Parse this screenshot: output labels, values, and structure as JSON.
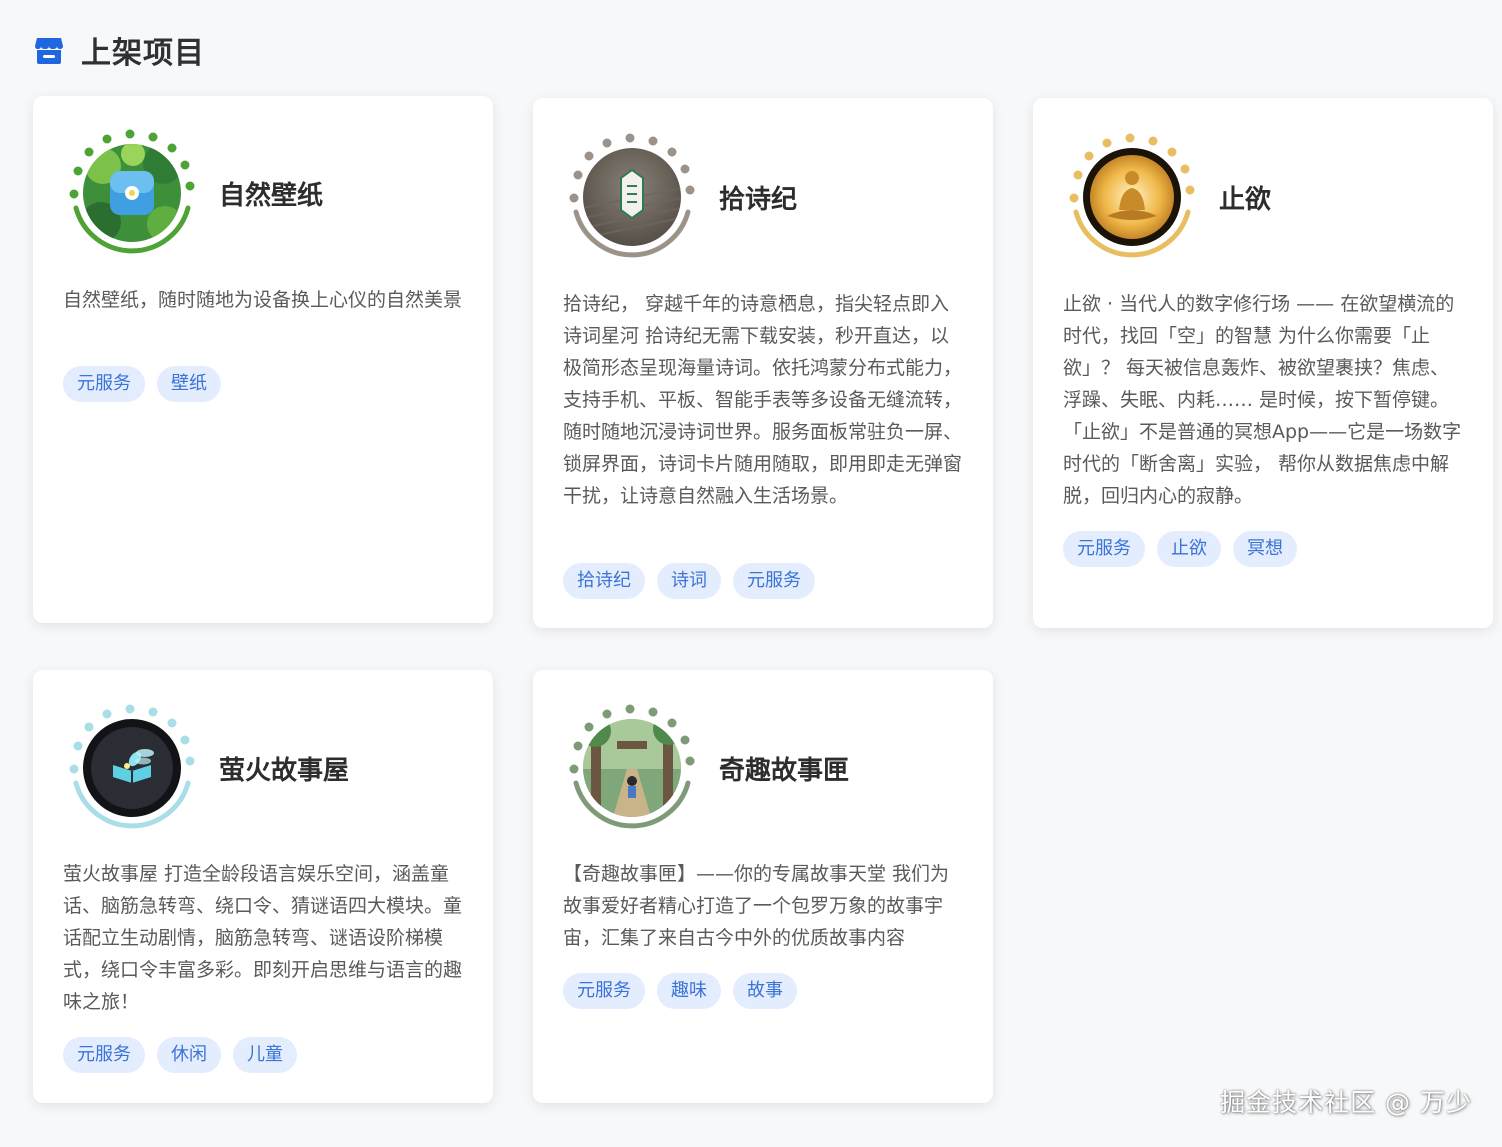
{
  "section": {
    "title": "上架项目",
    "icon": "store-icon"
  },
  "cards": [
    {
      "title": "自然壁纸",
      "avatar_icon": "nature-wallpaper-app-icon",
      "ring_color": "#4ea336",
      "description": "自然壁纸，随时随地为设备换上心仪的自然美景",
      "tags": [
        "元服务",
        "壁纸"
      ]
    },
    {
      "title": "拾诗纪",
      "avatar_icon": "poetry-seal-app-icon",
      "ring_color": "#9b9389",
      "description": "拾诗纪， 穿越千年的诗意栖息，指尖轻点即入诗词星河 拾诗纪无需下载安装，秒开直达，以极简形态呈现海量诗词。依托鸿蒙分布式能力，支持手机、平板、智能手表等多设备无缝流转，随时随地沉浸诗词世界。服务面板常驻负一屏、锁屏界面，诗词卡片随用随取，即用即走无弹窗干扰，让诗意自然融入生活场景。",
      "tags": [
        "拾诗纪",
        "诗词",
        "元服务"
      ]
    },
    {
      "title": "止欲",
      "avatar_icon": "meditation-app-icon",
      "ring_color": "#e9bd62",
      "description": "止欲 · 当代人的数字修行场 —— 在欲望横流的时代，找回「空」的智慧 为什么你需要「止欲」？ 每天被信息轰炸、被欲望裹挟？焦虑、浮躁、失眠、内耗…… 是时候，按下暂停键。 「止欲」不是普通的冥想App——它是一场数字时代的「断舍离」实验， 帮你从数据焦虑中解脱，回归内心的寂静。",
      "tags": [
        "元服务",
        "止欲",
        "冥想"
      ]
    },
    {
      "title": "萤火故事屋",
      "avatar_icon": "firefly-book-app-icon",
      "ring_color": "#a9dde8",
      "description": "萤火故事屋 打造全龄段语言娱乐空间，涵盖童话、脑筋急转弯、绕口令、猜谜语四大模块。童话配立生动剧情，脑筋急转弯、谜语设阶梯模式，绕口令丰富多彩。即刻开启思维与语言的趣味之旅！",
      "tags": [
        "元服务",
        "休闲",
        "儿童"
      ]
    },
    {
      "title": "奇趣故事匣",
      "avatar_icon": "forest-story-app-icon",
      "ring_color": "#7e9a77",
      "description": "【奇趣故事匣】——你的专属故事天堂 我们为故事爱好者精心打造了一个包罗万象的故事宇宙，汇集了来自古今中外的优质故事内容",
      "tags": [
        "元服务",
        "趣味",
        "故事"
      ]
    }
  ],
  "watermark": "掘金技术社区 @ 万少"
}
